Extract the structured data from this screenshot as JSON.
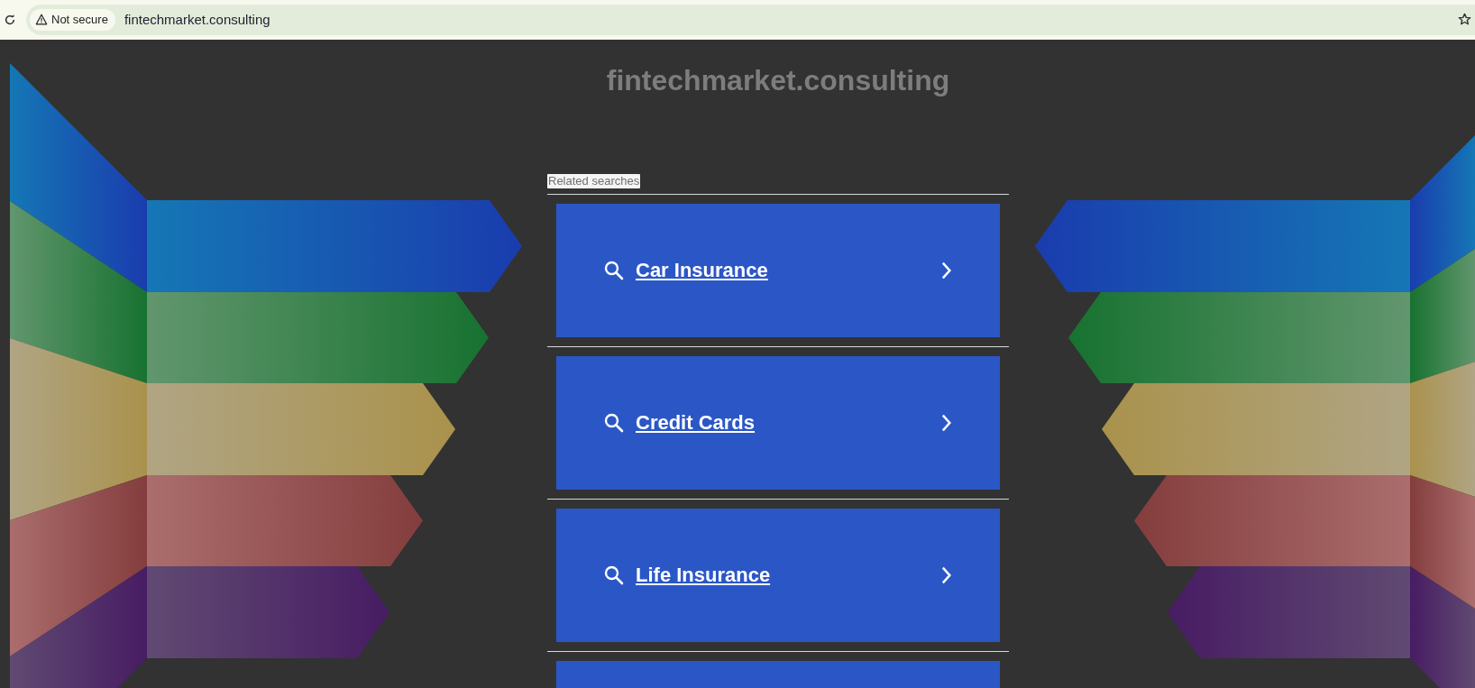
{
  "browser": {
    "security_label": "Not secure",
    "url": "fintechmarket.consulting"
  },
  "page": {
    "title": "fintechmarket.consulting",
    "section_label": "Related searches",
    "links": [
      {
        "label": "Car Insurance"
      },
      {
        "label": "Credit Cards"
      },
      {
        "label": "Life Insurance"
      }
    ]
  }
}
